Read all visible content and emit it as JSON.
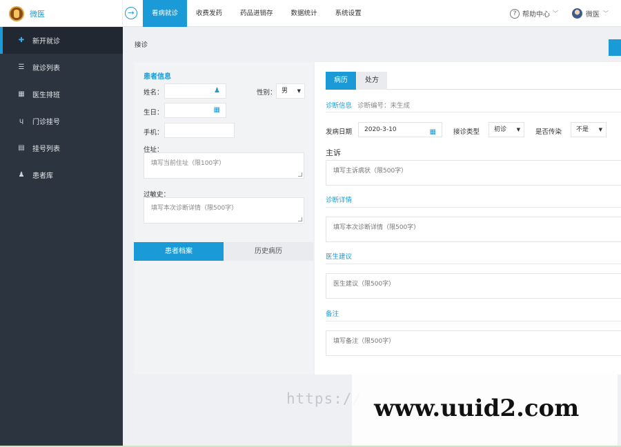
{
  "brand": {
    "name": "微医"
  },
  "nav": [
    {
      "label": "看病就诊",
      "active": true
    },
    {
      "label": "收费发药"
    },
    {
      "label": "药品进销存"
    },
    {
      "label": "数据统计"
    },
    {
      "label": "系统设置"
    }
  ],
  "topright": {
    "help": "帮助中心",
    "user": "微医"
  },
  "sidebar": {
    "items": [
      {
        "label": "新开就诊",
        "icon": "medical-kit-icon",
        "active": true
      },
      {
        "label": "就诊列表",
        "icon": "list-icon"
      },
      {
        "label": "医生排班",
        "icon": "calendar-icon"
      },
      {
        "label": "门诊挂号",
        "icon": "stethoscope-icon"
      },
      {
        "label": "挂号列表",
        "icon": "register-list-icon"
      },
      {
        "label": "患者库",
        "icon": "user-icon"
      }
    ]
  },
  "breadcrumb": "接诊",
  "patient": {
    "section_title": "患者信息",
    "name_label": "姓名：",
    "gender_label": "性别：",
    "gender_value": "男",
    "birthday_label": "生日：",
    "phone_label": "手机：",
    "address_label": "住址：",
    "address_placeholder": "填写当前住址（限100字）",
    "allergy_label": "过敏史：",
    "allergy_placeholder": "填写本次诊断详情（限500字）",
    "tabs": [
      {
        "label": "患者档案",
        "active": true
      },
      {
        "label": "历史病历"
      }
    ]
  },
  "record": {
    "tabs": [
      {
        "label": "病历",
        "active": true
      },
      {
        "label": "处方"
      }
    ],
    "diag_info": "诊断信息",
    "diag_number": "诊断编号：未生成",
    "onset_label": "发病日期",
    "onset_value": "2020-3-10",
    "visit_type_label": "接诊类型",
    "visit_type_value": "初诊",
    "contagious_label": "是否传染",
    "contagious_value": "不是",
    "complaint_title": "主诉",
    "complaint_placeholder": "填写主诉病状（限500字）",
    "detail_title": "诊断详情",
    "detail_placeholder": "填写本次诊断详情（限500字）",
    "advice_title": "医生建议",
    "advice_placeholder": "医生建议（限500字）",
    "note_title": "备注",
    "note_placeholder": "填写备注（限500字）"
  },
  "watermark": {
    "url": "https://",
    "site": "www.uuid2.com"
  },
  "colors": {
    "accent": "#1a9ad6",
    "sidebar": "#2c343f",
    "sidebar_active": "#222831"
  }
}
